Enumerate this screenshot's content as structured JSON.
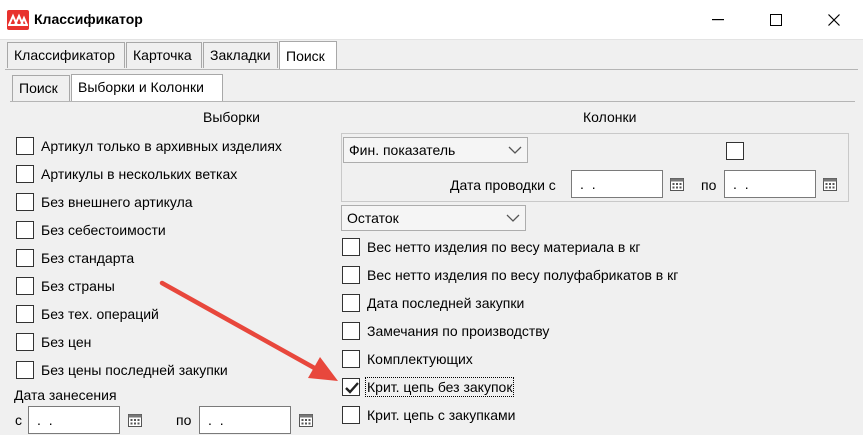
{
  "window": {
    "title": "Классификатор",
    "icon": "app-logo-icon",
    "controls": [
      "minimize-icon",
      "maximize-icon",
      "close-icon"
    ]
  },
  "tabs": [
    {
      "label": "Классификатор",
      "active": false
    },
    {
      "label": "Карточка",
      "active": false
    },
    {
      "label": "Закладки",
      "active": false
    },
    {
      "label": "Поиск",
      "active": true
    }
  ],
  "subtabs": [
    {
      "label": "Поиск",
      "active": false
    },
    {
      "label": "Выборки и Колонки",
      "active": true
    }
  ],
  "selections": {
    "title": "Выборки",
    "items": [
      {
        "label": "Артикул только в архивных изделиях",
        "checked": false
      },
      {
        "label": "Артикулы в нескольких ветках",
        "checked": false
      },
      {
        "label": "Без внешнего артикула",
        "checked": false
      },
      {
        "label": "Без себестоимости",
        "checked": false
      },
      {
        "label": "Без стандарта",
        "checked": false
      },
      {
        "label": "Без страны",
        "checked": false
      },
      {
        "label": "Без тех. операций",
        "checked": false
      },
      {
        "label": "Без цен",
        "checked": false
      },
      {
        "label": "Без цены последней закупки",
        "checked": false
      }
    ],
    "date_entry": {
      "label": "Дата занесения",
      "from_label": "с",
      "from_value": " .  . ",
      "to_label": "по",
      "to_value": " .  . "
    }
  },
  "columns": {
    "title": "Колонки",
    "fin_indicator": {
      "value": "Фин. показатель",
      "checked": false
    },
    "posting_date": {
      "label": "Дата проводки с",
      "from_value": " .  . ",
      "to_label": "по",
      "to_value": " .  . "
    },
    "balance_select": {
      "value": "Остаток"
    },
    "items": [
      {
        "label": "Вес нетто изделия по весу материала в кг",
        "checked": false
      },
      {
        "label": "Вес нетто изделия по весу полуфабрикатов в кг",
        "checked": false
      },
      {
        "label": "Дата последней закупки",
        "checked": false
      },
      {
        "label": "Замечания по производству",
        "checked": false
      },
      {
        "label": "Комплектующих",
        "checked": false
      },
      {
        "label": "Крит. цепь без закупок",
        "checked": true
      },
      {
        "label": "Крит. цепь с закупками",
        "checked": false
      }
    ]
  },
  "colors": {
    "annotation_arrow": "#e8473c",
    "app_icon": "#e8322e"
  }
}
